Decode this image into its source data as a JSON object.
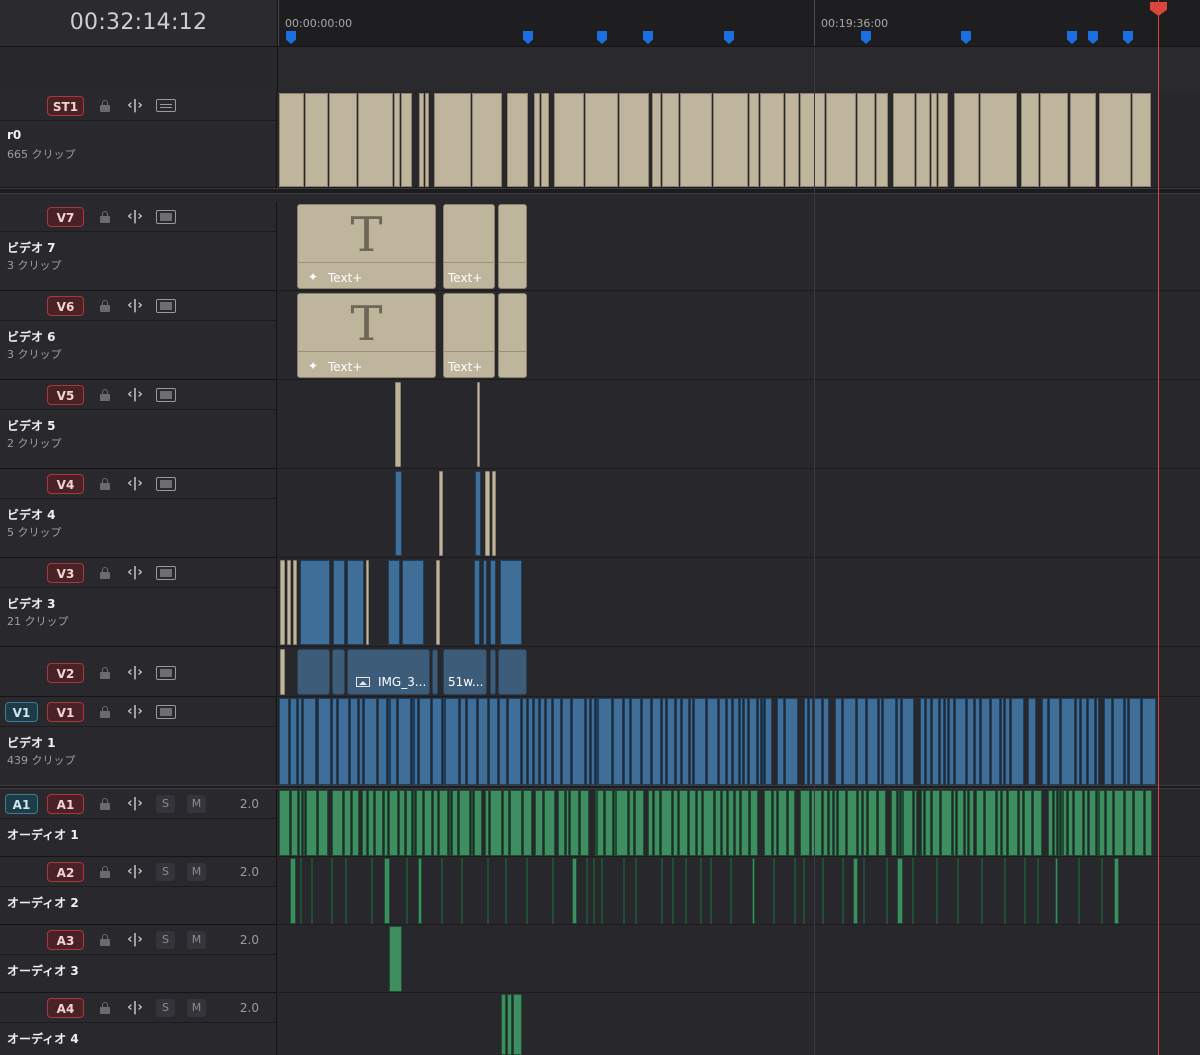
{
  "timecode": "00:32:14:12",
  "ruler": {
    "label_start": "00:00:00:00",
    "label_mid": "00:19:36:00"
  },
  "tracks": {
    "st1": {
      "badge": "ST1",
      "name": "r0",
      "count": "665 クリップ"
    },
    "v7": {
      "badge": "V7",
      "name": "ビデオ 7",
      "count": "3 クリップ"
    },
    "v6": {
      "badge": "V6",
      "name": "ビデオ 6",
      "count": "3 クリップ"
    },
    "v5": {
      "badge": "V5",
      "name": "ビデオ 5",
      "count": "2 クリップ"
    },
    "v4": {
      "badge": "V4",
      "name": "ビデオ 4",
      "count": "5 クリップ"
    },
    "v3": {
      "badge": "V3",
      "name": "ビデオ 3",
      "count": "21 クリップ"
    },
    "v2": {
      "badge": "V2"
    },
    "v1": {
      "source_badge": "V1",
      "badge": "V1",
      "name": "ビデオ 1",
      "count": "439 クリップ"
    },
    "a1": {
      "source_badge": "A1",
      "badge": "A1",
      "name": "オーディオ 1",
      "solo": "S",
      "mute": "M",
      "volume": "2.0"
    },
    "a2": {
      "badge": "A2",
      "name": "オーディオ 2",
      "solo": "S",
      "mute": "M",
      "volume": "2.0"
    },
    "a3": {
      "badge": "A3",
      "name": "オーディオ 3",
      "solo": "S",
      "mute": "M",
      "volume": "2.0"
    },
    "a4": {
      "badge": "A4",
      "name": "オーディオ 4",
      "solo": "S",
      "mute": "M",
      "volume": "2.0"
    }
  },
  "clips": {
    "text_plus": "Text+",
    "text_glyph": "T",
    "v2_img": "IMG_3...",
    "v2_51w": "51w..."
  },
  "colors": {
    "subtitle_clip": "#bfb59c",
    "video_clip": "#3f6f99",
    "audio_clip": "#3f8e62",
    "playhead": "#d8463c",
    "marker": "#1b6fe0",
    "record_badge": "#a8383c",
    "source_badge": "#3b7d94"
  },
  "icons": [
    "lock-icon",
    "link-icon",
    "film-icon",
    "caption-icon",
    "image-icon",
    "sparkle-icon"
  ]
}
